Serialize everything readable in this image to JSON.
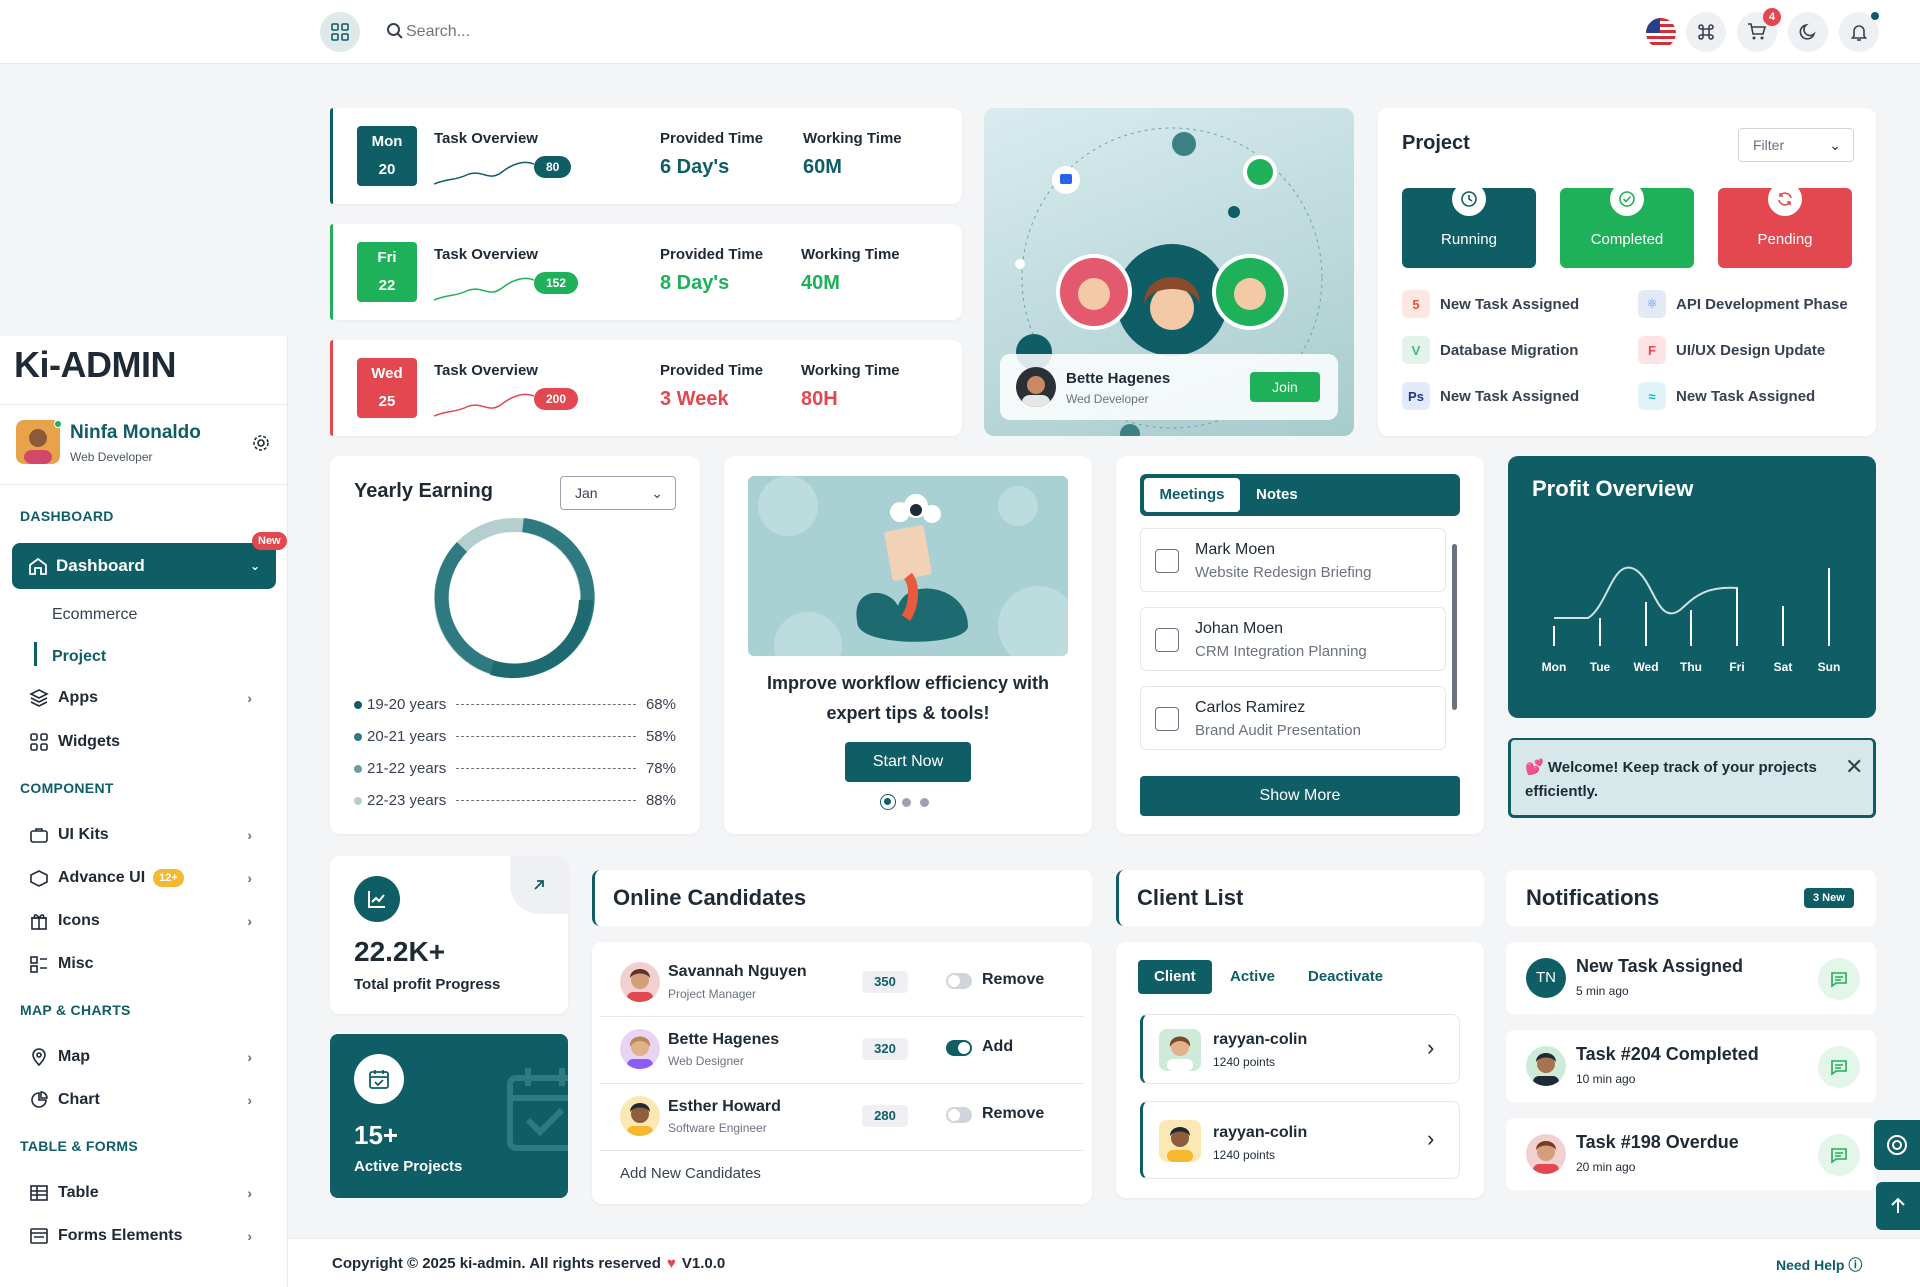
{
  "topbar": {
    "search_placeholder": "Search...",
    "cart_badge": "4"
  },
  "sidebar": {
    "logo": "Ki-ADMIN",
    "user_name": "Ninfa Monaldo",
    "user_role": "Web Developer",
    "section_dashboard": "DASHBOARD",
    "dashboard_label": "Dashboard",
    "dashboard_badge": "New",
    "sub_ecommerce": "Ecommerce",
    "sub_project": "Project",
    "apps": "Apps",
    "widgets": "Widgets",
    "section_component": "COMPONENT",
    "ui_kits": "UI Kits",
    "advance_ui": "Advance UI",
    "advance_badge": "12+",
    "icons": "Icons",
    "misc": "Misc",
    "section_map": "MAP & CHARTS",
    "map": "Map",
    "chart": "Chart",
    "section_table": "TABLE & FORMS",
    "table": "Table",
    "forms": "Forms Elements"
  },
  "tasks": [
    {
      "day": "Mon",
      "date": "20",
      "title": "Task Overview",
      "badge": "80",
      "provided_label": "Provided Time",
      "provided": "6 Day's",
      "working_label": "Working Time",
      "working": "60M",
      "color": "#0f5e66"
    },
    {
      "day": "Fri",
      "date": "22",
      "title": "Task Overview",
      "badge": "152",
      "provided_label": "Provided Time",
      "provided": "8 Day's",
      "working_label": "Working Time",
      "working": "40M",
      "color": "#1fb15a"
    },
    {
      "day": "Wed",
      "date": "25",
      "title": "Task Overview",
      "badge": "200",
      "provided_label": "Provided Time",
      "provided": "3 Week",
      "working_label": "Working Time",
      "working": "80H",
      "color": "#e34850"
    }
  ],
  "meetcard": {
    "name": "Bette Hagenes",
    "role": "Wed Developer",
    "join": "Join"
  },
  "project": {
    "title": "Project",
    "filter": "Filter",
    "running": "Running",
    "completed": "Completed",
    "pending": "Pending",
    "items": [
      "New Task Assigned",
      "API Development Phase",
      "Database Migration",
      "UI/UX Design Update",
      "New Task Assigned",
      "New Task Assigned"
    ]
  },
  "earning": {
    "title": "Yearly Earning",
    "month": "Jan",
    "rows": [
      {
        "label": "19-20 years",
        "value": "68%"
      },
      {
        "label": "20-21 years",
        "value": "58%"
      },
      {
        "label": "21-22 years",
        "value": "78%"
      },
      {
        "label": "22-23 years",
        "value": "88%"
      }
    ]
  },
  "promo": {
    "text": "Improve workflow efficiency with expert tips & tools!",
    "button": "Start Now"
  },
  "meetings": {
    "tab_meetings": "Meetings",
    "tab_notes": "Notes",
    "items": [
      {
        "name": "Mark Moen",
        "subject": "Website Redesign Briefing"
      },
      {
        "name": "Johan Moen",
        "subject": "CRM Integration Planning"
      },
      {
        "name": "Carlos Ramirez",
        "subject": "Brand Audit Presentation"
      }
    ],
    "show_more": "Show More"
  },
  "profit": {
    "title": "Profit Overview",
    "days": [
      "Mon",
      "Tue",
      "Wed",
      "Thu",
      "Fri",
      "Sat",
      "Sun"
    ]
  },
  "alert": {
    "text": "💕 Welcome! Keep track of your projects efficiently."
  },
  "stats": {
    "profit_value": "22.2K+",
    "profit_label": "Total profit Progress",
    "projects_value": "15+",
    "projects_label": "Active Projects"
  },
  "candidates": {
    "title": "Online Candidates",
    "rows": [
      {
        "name": "Savannah Nguyen",
        "role": "Project Manager",
        "score": "350",
        "action": "Remove"
      },
      {
        "name": "Bette Hagenes",
        "role": "Web Designer",
        "score": "320",
        "action": "Add"
      },
      {
        "name": "Esther Howard",
        "role": "Software Engineer",
        "score": "280",
        "action": "Remove"
      }
    ],
    "add_new": "Add New Candidates"
  },
  "clients": {
    "title": "Client List",
    "tab_client": "Client",
    "tab_active": "Active",
    "tab_deactivate": "Deactivate",
    "rows": [
      {
        "name": "rayyan-colin",
        "points": "1240 points"
      },
      {
        "name": "rayyan-colin",
        "points": "1240 points"
      }
    ]
  },
  "notifications": {
    "title": "Notifications",
    "badge": "3 New",
    "items": [
      {
        "title": "New Task Assigned",
        "time": "5 min ago",
        "initials": "TN"
      },
      {
        "title": "Task #204 Completed",
        "time": "10 min ago"
      },
      {
        "title": "Task #198 Overdue",
        "time": "20 min ago"
      }
    ]
  },
  "footer": {
    "copyright": "Copyright © 2025 ki-admin. All rights reserved",
    "version": "V1.0.0",
    "help": "Need Help"
  }
}
